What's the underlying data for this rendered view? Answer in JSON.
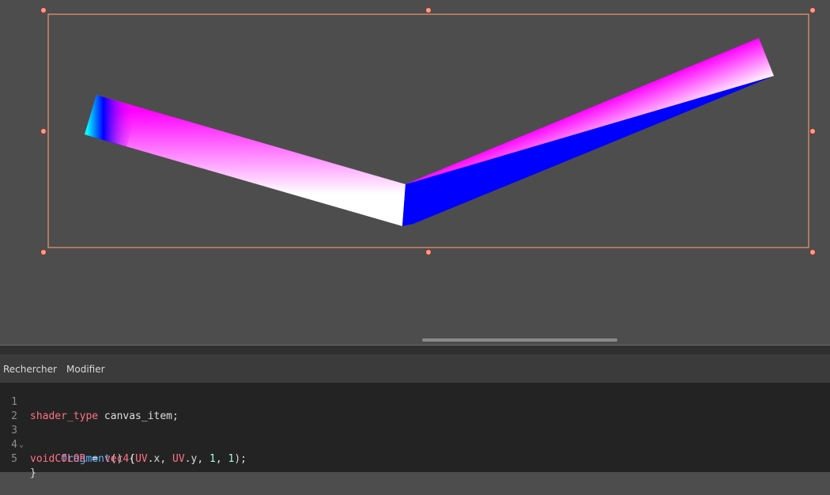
{
  "colors": {
    "viewport_bg": "#4d4d4d",
    "selection_outline": "#e0926a",
    "handle_fill": "#ff9a8a",
    "editor_bg": "#232323",
    "keyword": "#ff7085",
    "function": "#57b3ff",
    "number": "#a1ffe0"
  },
  "icons": {
    "fold": "chevron-down-icon",
    "handle": "resize-handle-icon"
  },
  "editor_menu": {
    "search": "Rechercher",
    "edit": "Modifier"
  },
  "code": {
    "line_numbers": [
      "1",
      "2",
      "3",
      "4",
      "5"
    ],
    "l1_kw": "shader_type",
    "l1_rest": " canvas_item;",
    "l3_kw": "void",
    "l3_space": " ",
    "l3_fn": "fragment",
    "l3_rest": "() {",
    "l4_indent": "    ",
    "l4_color": "COLOR",
    "l4_eq": " = ",
    "l4_vec": "vec4",
    "l4_open": "(",
    "l4_uv1": "UV",
    "l4_x": ".x, ",
    "l4_uv2": "UV",
    "l4_y": ".y, ",
    "l4_one1": "1",
    "l4_comma": ", ",
    "l4_one2": "1",
    "l4_close": ");",
    "l5": "}"
  }
}
